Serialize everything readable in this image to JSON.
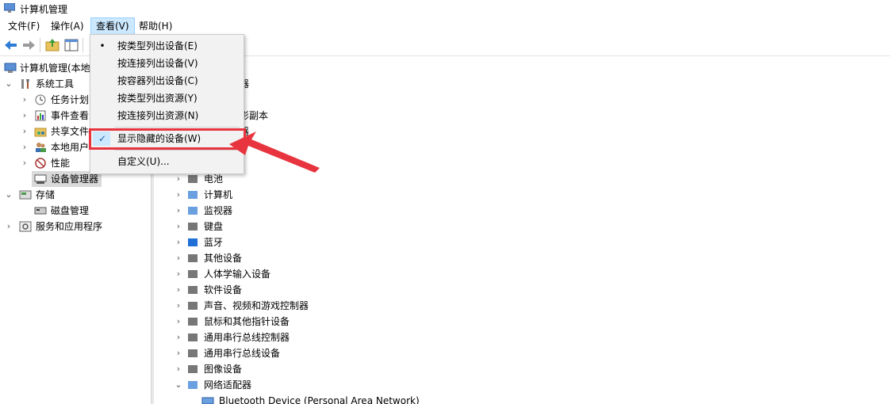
{
  "window": {
    "title": "计算机管理"
  },
  "menubar": {
    "file": "文件(F)",
    "action": "操作(A)",
    "view": "查看(V)",
    "help": "帮助(H)"
  },
  "view_menu": {
    "items": [
      {
        "label": "按类型列出设备(E)",
        "mark": "•"
      },
      {
        "label": "按连接列出设备(V)",
        "mark": ""
      },
      {
        "label": "按容器列出设备(C)",
        "mark": ""
      },
      {
        "label": "按类型列出资源(Y)",
        "mark": ""
      },
      {
        "label": "按连接列出资源(N)",
        "mark": ""
      },
      {
        "label": "显示隐藏的设备(W)",
        "mark": "✓"
      },
      {
        "label": "自定义(U)...",
        "mark": ""
      }
    ]
  },
  "left_tree": {
    "root": "计算机管理(本地",
    "system_tools": "系统工具",
    "task_scheduler": "任务计划",
    "event_viewer": "事件查看",
    "shared_folders": "共享文件",
    "local_users": "本地用户",
    "performance": "性能",
    "device_manager": "设备管理器",
    "storage": "存储",
    "disk_management": "磁盘管理",
    "services": "服务和应用程序"
  },
  "right_tree": {
    "partial_1": "器",
    "partial_2": "影副本",
    "partial_3": "器",
    "items": [
      "电池",
      "计算机",
      "监视器",
      "键盘",
      "蓝牙",
      "其他设备",
      "人体学输入设备",
      "软件设备",
      "声音、视频和游戏控制器",
      "鼠标和其他指针设备",
      "通用串行总线控制器",
      "通用串行总线设备",
      "图像设备",
      "网络适配器"
    ],
    "child_item": "Bluetooth Device (Personal Area Network)"
  },
  "colors": {
    "highlight_red": "#e8343f",
    "menu_hover": "#cce8ff",
    "selection": "#d9d9d9"
  }
}
